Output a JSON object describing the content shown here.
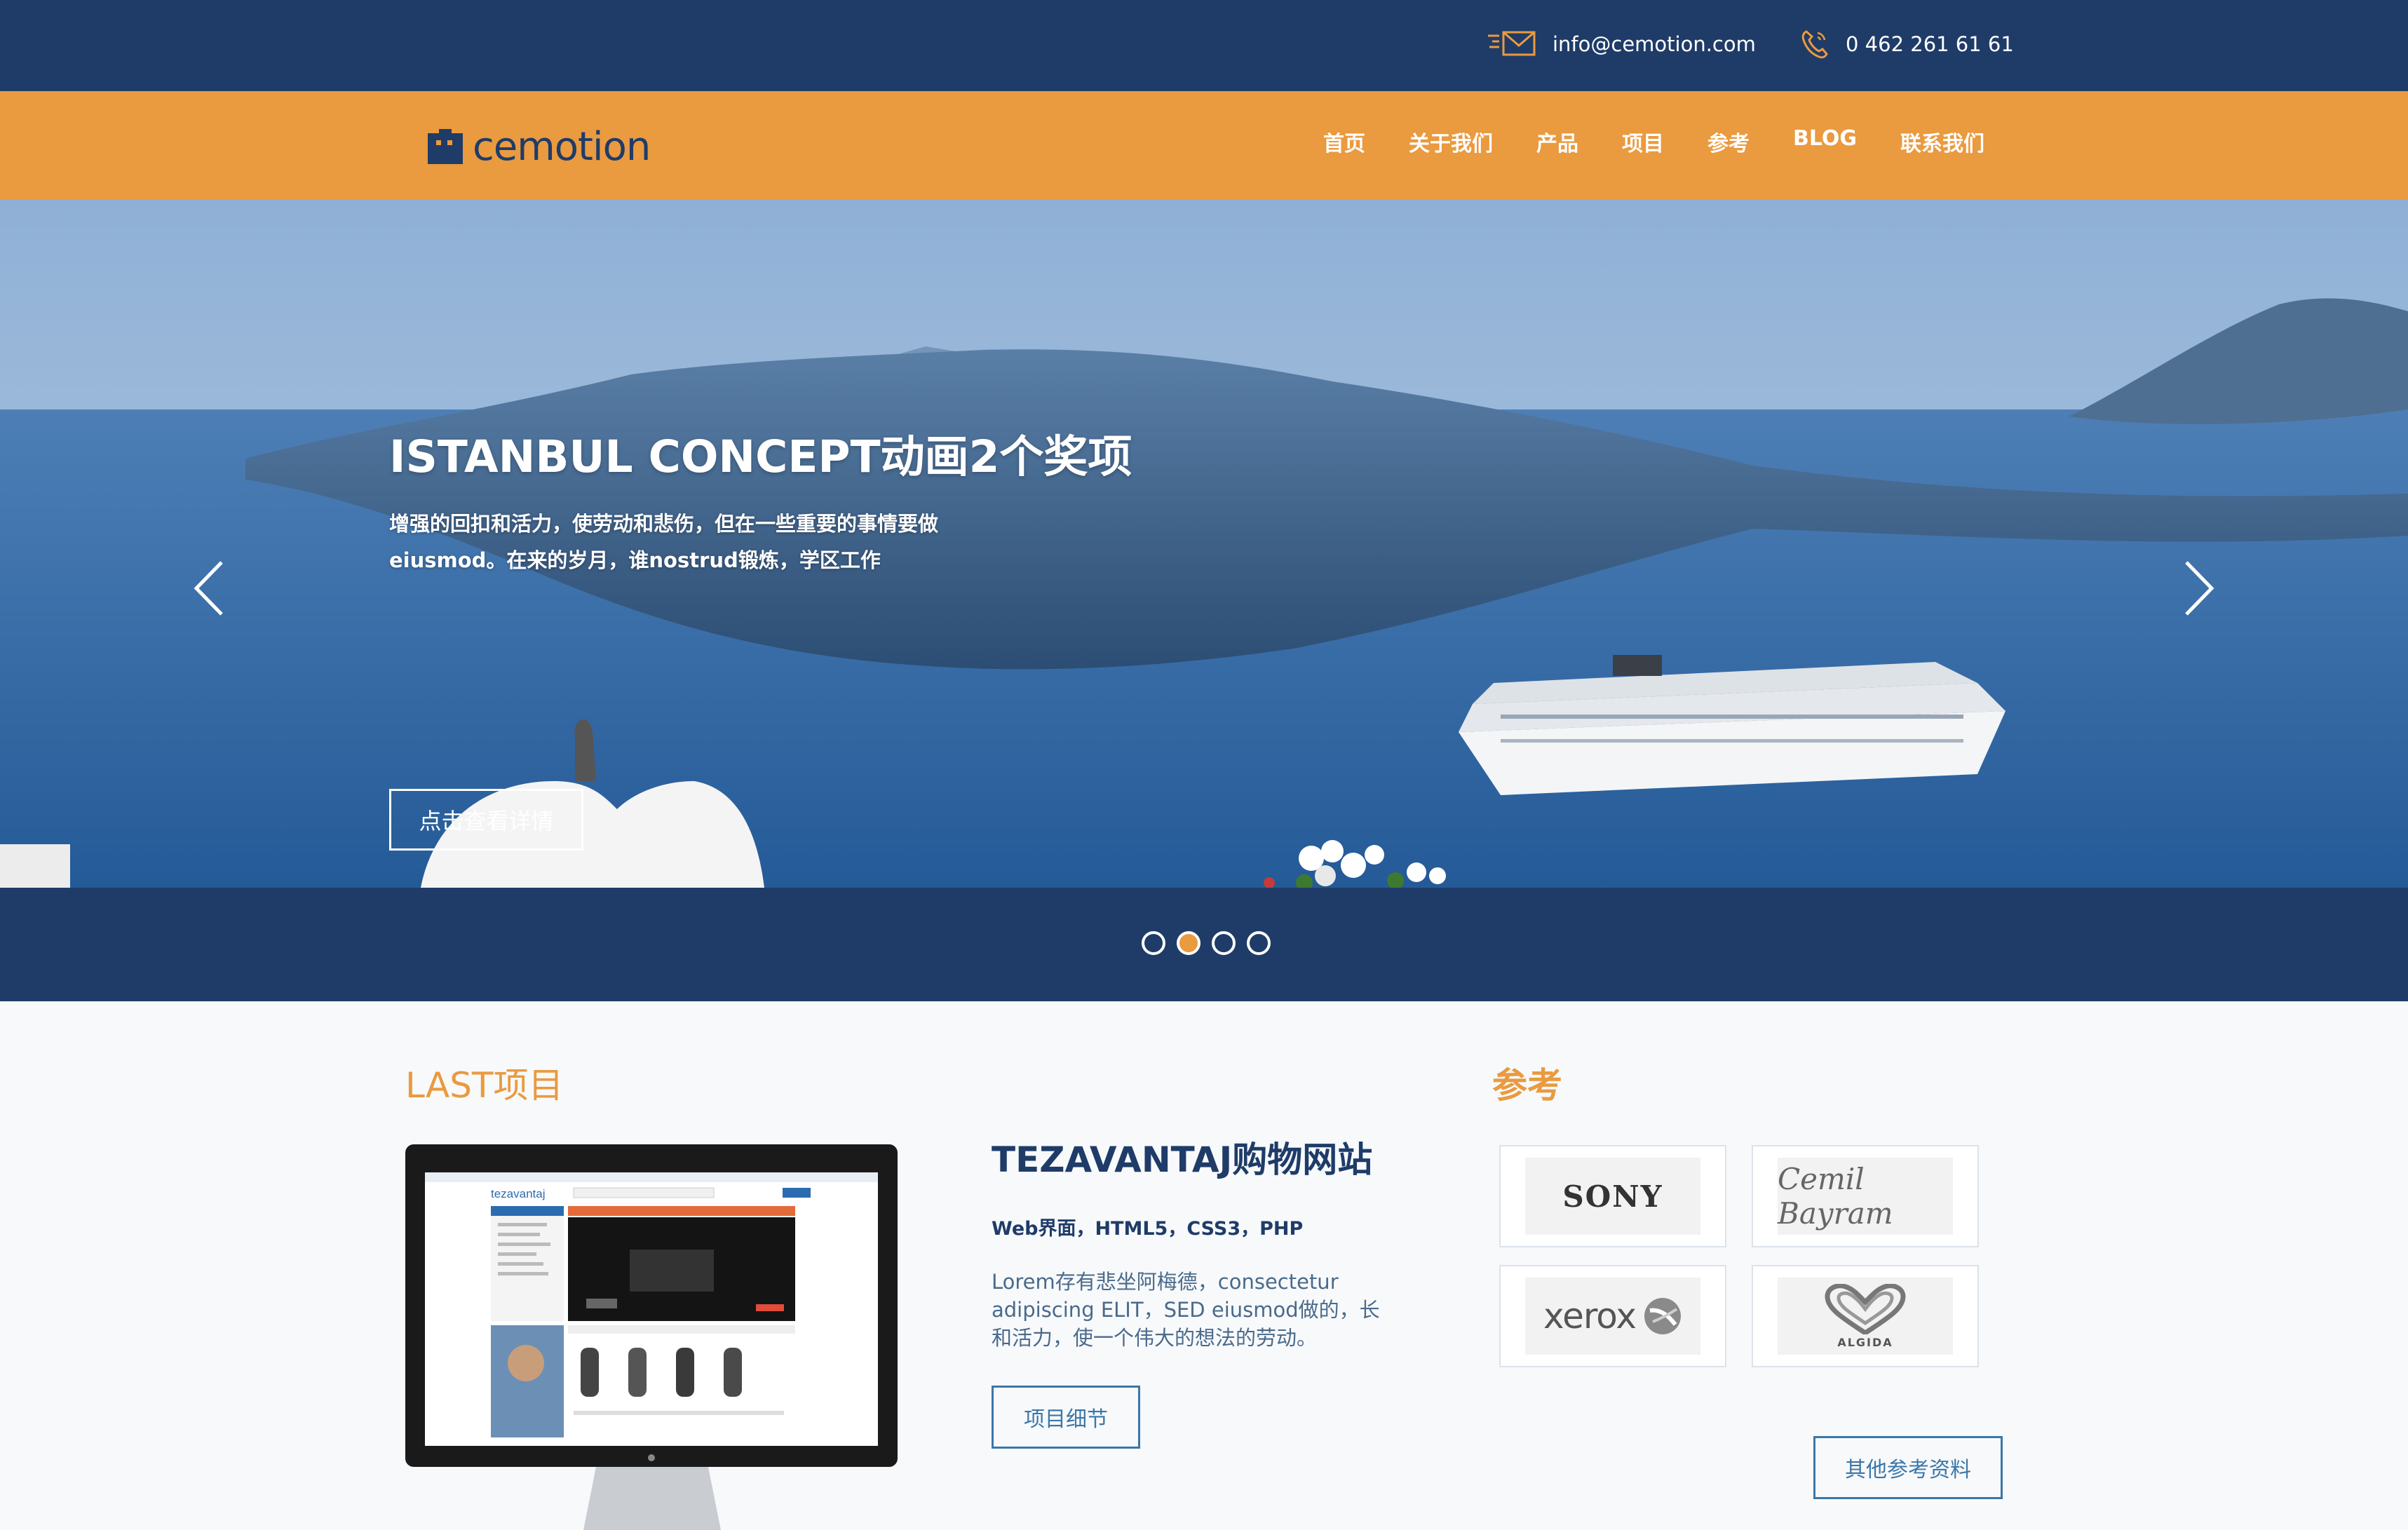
{
  "topbar": {
    "email": "info@cemotion.com",
    "phone": "0 462 261 61 61",
    "email_icon": "envelope-icon",
    "phone_icon": "phone-icon"
  },
  "brand": {
    "name": "cemotion",
    "logo_icon": "cemotion-logo-icon"
  },
  "nav": {
    "items": [
      "首页",
      "关于我们",
      "产品",
      "项目",
      "参考",
      "BLOG",
      "联系我们"
    ]
  },
  "hero": {
    "title": "ISTANBUL CONCEPT动画2个奖项",
    "description": "增强的回扣和活力，使劳动和悲伤，但在一些重要的事情要做eiusmod。在来的岁月，谁nostrud锻炼，学区工作",
    "button": "点击查看详情",
    "prev_icon": "chevron-left-icon",
    "next_icon": "chevron-right-icon",
    "slide_count": 4,
    "active_slide": 2
  },
  "projects": {
    "section_title": "LAST项目",
    "title": "TEZAVANTAJ购物网站",
    "tech": "Web界面，HTML5，CSS3，PHP",
    "description": "Lorem存有悲坐阿梅德，consectetur adipiscing ELIT，SED eiusmod做的，长和活力，使一个伟大的想法的劳动。",
    "button": "项目细节",
    "screen_logo": "tezavantaj"
  },
  "references": {
    "section_title": "参考",
    "logos": [
      {
        "name": "SONY"
      },
      {
        "name": "Cemil Bayram"
      },
      {
        "name": "xerox"
      },
      {
        "name": "ALGIDA"
      }
    ],
    "button": "其他参考资料"
  },
  "colors": {
    "navy": "#1f3c68",
    "orange": "#ea9a3f",
    "link_blue": "#3b77a8"
  }
}
